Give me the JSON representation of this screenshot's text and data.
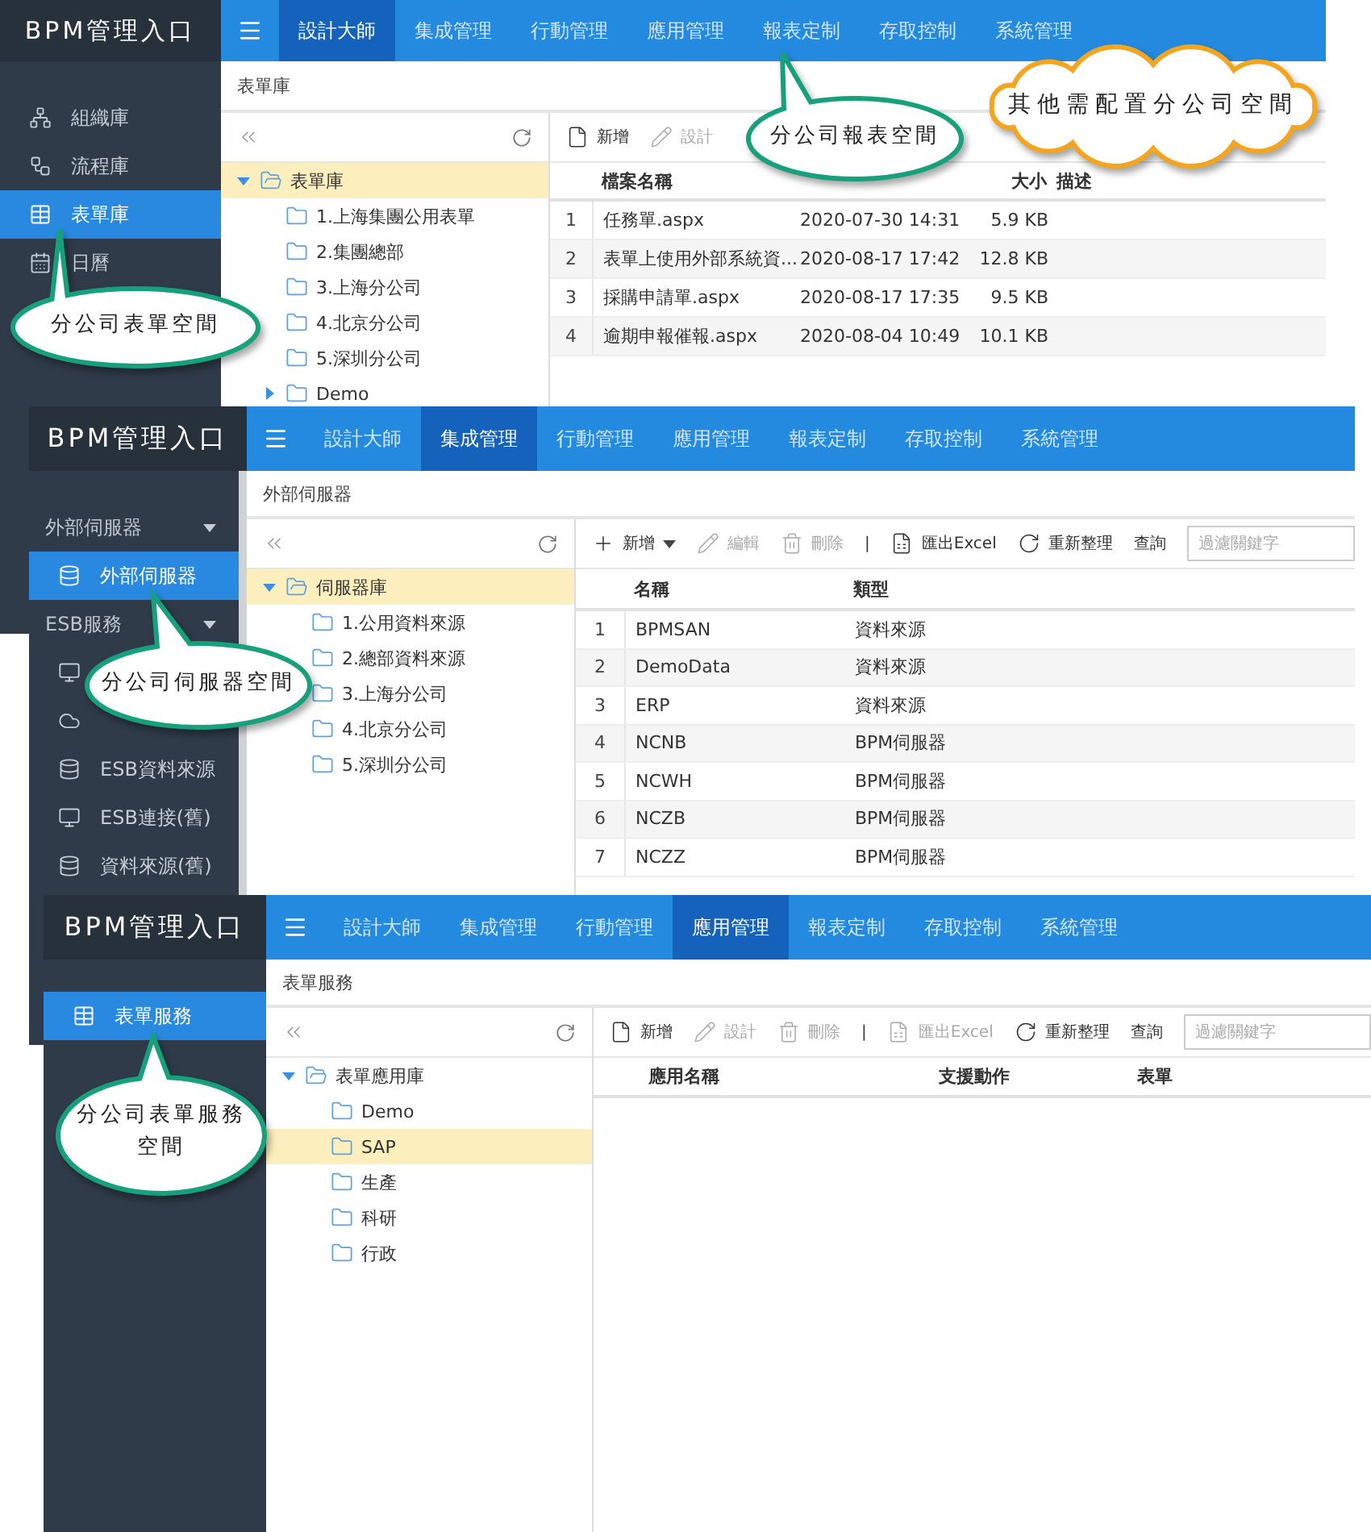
{
  "screens": [
    {
      "brand": "BPM管理入口",
      "nav_tabs": [
        {
          "label": "設計大師",
          "selected": true
        },
        {
          "label": "集成管理",
          "selected": false
        },
        {
          "label": "行動管理",
          "selected": false
        },
        {
          "label": "應用管理",
          "selected": false
        },
        {
          "label": "報表定制",
          "selected": false
        },
        {
          "label": "存取控制",
          "selected": false
        },
        {
          "label": "系統管理",
          "selected": false
        }
      ],
      "sidebar": [
        {
          "kind": "item",
          "label": "組織庫",
          "selected": false
        },
        {
          "kind": "item",
          "label": "流程庫",
          "selected": false
        },
        {
          "kind": "item",
          "label": "表單庫",
          "selected": true
        },
        {
          "kind": "item",
          "label": "日曆",
          "selected": false
        }
      ],
      "breadcrumb": "表單庫",
      "tree": [
        {
          "label": "表單庫",
          "expanded": true,
          "selected": true,
          "children": [
            {
              "label": "1.上海集團公用表單",
              "selected": false
            },
            {
              "label": "2.集團總部",
              "selected": false
            },
            {
              "label": "3.上海分公司",
              "selected": false
            },
            {
              "label": "4.北京分公司",
              "selected": false
            },
            {
              "label": "5.深圳分公司",
              "selected": false
            },
            {
              "label": "Demo",
              "expanded": false,
              "selected": false
            }
          ]
        }
      ],
      "toolbar": [
        {
          "kind": "new",
          "label": "新增",
          "disabled": false
        },
        {
          "kind": "edit",
          "label": "設計",
          "disabled": true
        }
      ],
      "table": {
        "columns": [
          {
            "kind": "text",
            "label": "檔案名稱"
          },
          {
            "kind": "text"
          },
          {
            "kind": "numeric",
            "label": "大小"
          },
          {
            "kind": "text",
            "label": "描述"
          }
        ],
        "rows": [
          {
            "number": "1",
            "cells": [
              "任務單.aspx",
              "2020-07-30 14:31",
              "5.9 KB"
            ]
          },
          {
            "number": "2",
            "cells": [
              "表單上使用外部系統資...",
              "2020-08-17 17:42",
              "12.8 KB"
            ]
          },
          {
            "number": "3",
            "cells": [
              "採購申請單.aspx",
              "2020-08-17 17:35",
              "9.5 KB"
            ]
          },
          {
            "number": "4",
            "cells": [
              "逾期申報催報.aspx",
              "2020-08-04 10:49",
              "10.1 KB"
            ]
          }
        ]
      }
    },
    {
      "brand": "BPM管理入口",
      "nav_tabs": [
        {
          "label": "設計大師",
          "selected": false
        },
        {
          "label": "集成管理",
          "selected": true
        },
        {
          "label": "行動管理",
          "selected": false
        },
        {
          "label": "應用管理",
          "selected": false
        },
        {
          "label": "報表定制",
          "selected": false
        },
        {
          "label": "存取控制",
          "selected": false
        },
        {
          "label": "系統管理",
          "selected": false
        }
      ],
      "sidebar": [
        {
          "kind": "group",
          "label": "外部伺服器",
          "expanded": true
        },
        {
          "kind": "item",
          "label": "外部伺服器",
          "selected": true
        },
        {
          "kind": "group",
          "label": "ESB服務",
          "expanded": true
        },
        {
          "kind": "item",
          "selected": false
        },
        {
          "kind": "item",
          "selected": false
        },
        {
          "kind": "item",
          "label": "ESB資料來源",
          "selected": false
        },
        {
          "kind": "item",
          "label": "ESB連接(舊)",
          "selected": false
        },
        {
          "kind": "item",
          "label": "資料來源(舊)",
          "selected": false
        }
      ],
      "breadcrumb": "外部伺服器",
      "tree": [
        {
          "label": "伺服器庫",
          "expanded": true,
          "selected": true,
          "children": [
            {
              "label": "1.公用資料來源",
              "selected": false
            },
            {
              "label": "2.總部資料來源",
              "selected": false
            },
            {
              "label": "3.上海分公司",
              "selected": false
            },
            {
              "label": "4.北京分公司",
              "selected": false
            },
            {
              "label": "5.深圳分公司",
              "selected": false
            }
          ]
        }
      ],
      "toolbar": [
        {
          "kind": "new-menu",
          "label": "新增",
          "disabled": false
        },
        {
          "kind": "edit",
          "label": "編輯",
          "disabled": true
        },
        {
          "kind": "delete",
          "label": "刪除",
          "disabled": true
        },
        {
          "kind": "separator",
          "label": "|"
        },
        {
          "kind": "export",
          "label": "匯出Excel",
          "disabled": false
        },
        {
          "kind": "refresh",
          "label": "重新整理",
          "disabled": false
        },
        {
          "kind": "label",
          "label": "查詢"
        }
      ],
      "filter": {
        "placeholder": "過濾關鍵字"
      },
      "table": {
        "columns": [
          {
            "kind": "text",
            "label": "名稱"
          },
          {
            "kind": "text",
            "label": "類型"
          }
        ],
        "rows": [
          {
            "number": "1",
            "cells": [
              "BPMSAN",
              "資料來源"
            ]
          },
          {
            "number": "2",
            "cells": [
              "DemoData",
              "資料來源"
            ]
          },
          {
            "number": "3",
            "cells": [
              "ERP",
              "資料來源"
            ]
          },
          {
            "number": "4",
            "cells": [
              "NCNB",
              "BPM伺服器"
            ]
          },
          {
            "number": "5",
            "cells": [
              "NCWH",
              "BPM伺服器"
            ]
          },
          {
            "number": "6",
            "cells": [
              "NCZB",
              "BPM伺服器"
            ]
          },
          {
            "number": "7",
            "cells": [
              "NCZZ",
              "BPM伺服器"
            ]
          }
        ]
      }
    },
    {
      "brand": "BPM管理入口",
      "nav_tabs": [
        {
          "label": "設計大師",
          "selected": false
        },
        {
          "label": "集成管理",
          "selected": false
        },
        {
          "label": "行動管理",
          "selected": false
        },
        {
          "label": "應用管理",
          "selected": true
        },
        {
          "label": "報表定制",
          "selected": false
        },
        {
          "label": "存取控制",
          "selected": false
        },
        {
          "label": "系統管理",
          "selected": false
        }
      ],
      "sidebar": [
        {
          "kind": "item",
          "label": "表單服務",
          "selected": true
        }
      ],
      "breadcrumb": "表單服務",
      "tree": [
        {
          "label": "表單應用庫",
          "expanded": true,
          "selected": false,
          "children": [
            {
              "label": "Demo",
              "selected": false
            },
            {
              "label": "SAP",
              "selected": true
            },
            {
              "label": "生產",
              "selected": false
            },
            {
              "label": "科研",
              "selected": false
            },
            {
              "label": "行政",
              "selected": false
            }
          ]
        }
      ],
      "toolbar": [
        {
          "kind": "new",
          "label": "新增",
          "disabled": false
        },
        {
          "kind": "edit",
          "label": "設計",
          "disabled": true
        },
        {
          "kind": "delete",
          "label": "刪除",
          "disabled": true
        },
        {
          "kind": "separator",
          "label": "|"
        },
        {
          "kind": "export",
          "label": "匯出Excel",
          "disabled": true
        },
        {
          "kind": "refresh",
          "label": "重新整理",
          "disabled": false
        },
        {
          "kind": "label",
          "label": "查詢"
        }
      ],
      "filter": {
        "placeholder": "過濾關鍵字"
      },
      "table": {
        "columns": [
          {
            "kind": "text",
            "label": "應用名稱"
          },
          {
            "kind": "text",
            "label": "支援動作"
          },
          {
            "kind": "text",
            "label": "表單"
          }
        ]
      }
    }
  ],
  "callouts": [
    {
      "kind": "speech",
      "text": "分公司表單空間"
    },
    {
      "kind": "speech",
      "text": "分公司報表空間"
    },
    {
      "kind": "cloud",
      "text": "其他需配置分公司空間"
    },
    {
      "kind": "speech",
      "text": "分公司伺服器空間"
    },
    {
      "kind": "speech",
      "text": "分公司表單服務空間"
    }
  ]
}
